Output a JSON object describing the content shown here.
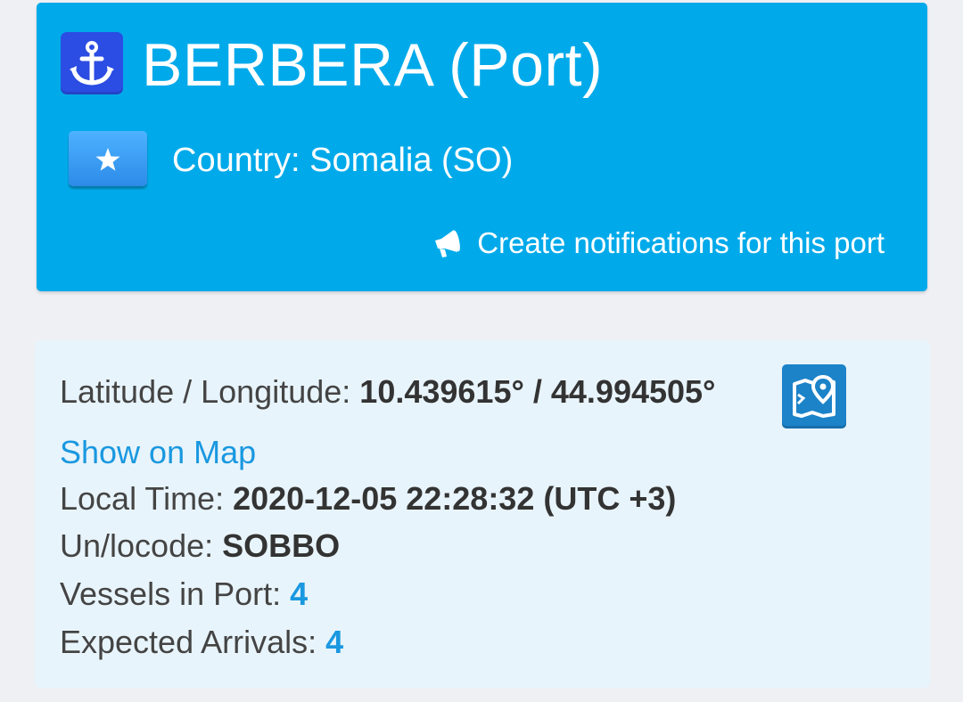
{
  "header": {
    "port_title": "BERBERA (Port)",
    "country_label": "Country: Somalia (SO)",
    "notify_label": "Create notifications for this port",
    "icons": {
      "anchor": "anchor-icon",
      "flag": "somalia-flag-icon",
      "notify": "megaphone-icon"
    },
    "colors": {
      "background": "#00aaea",
      "text": "#ffffff"
    }
  },
  "info": {
    "latlon_label": "Latitude / Longitude:",
    "latlon_value": "10.439615° / 44.994505°",
    "show_map_label": "Show on Map",
    "local_time_label": "Local Time:",
    "local_time_value": "2020-12-05 22:28:32 (UTC +3)",
    "locode_label": "Un/locode:",
    "locode_value": "SOBBO",
    "vessels_label": "Vessels in Port:",
    "vessels_value": "4",
    "arrivals_label": "Expected Arrivals:",
    "arrivals_value": "4",
    "icons": {
      "map": "map-pin-icon"
    },
    "colors": {
      "background": "#e8f4fb",
      "link": "#1a98e0"
    }
  }
}
